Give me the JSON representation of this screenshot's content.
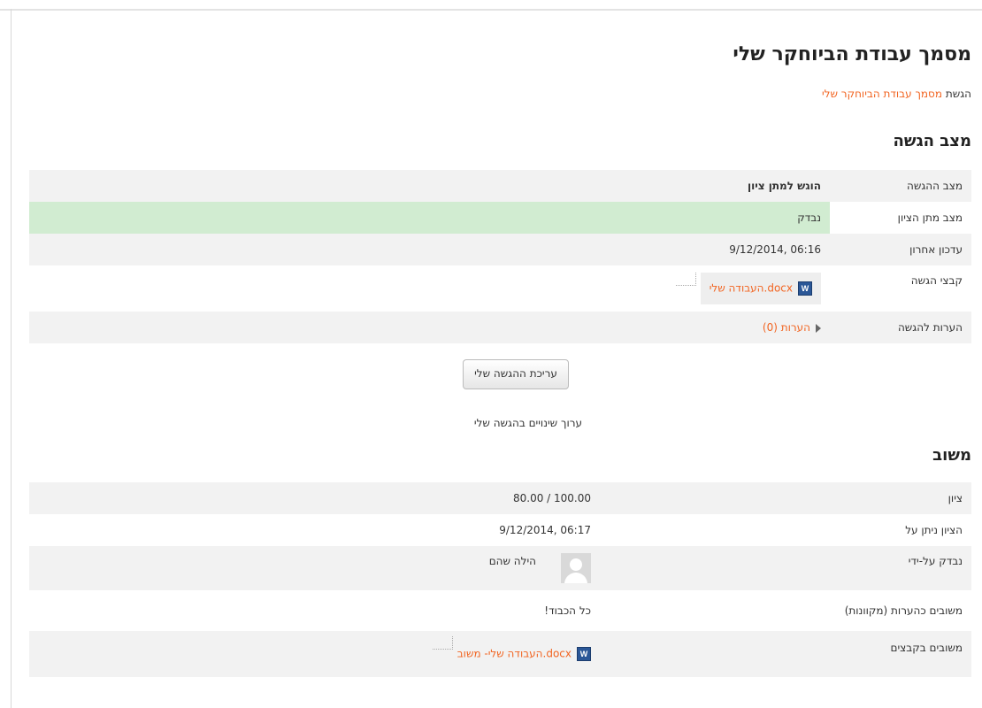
{
  "title": "מסמך עבודת הביוחקר שלי",
  "breadcrumb": {
    "prefix": "הגשת",
    "link": "מסמך עבודת הביוחקר שלי"
  },
  "submission_status": {
    "heading": "מצב הגשה",
    "rows": {
      "status_label": "מצב ההגשה",
      "status_value": "הוגש למתן ציון",
      "grading_label": "מצב מתן הציון",
      "grading_value": "נבדק",
      "modified_label": "עדכון אחרון",
      "modified_value": "9/12/2014, 06:16",
      "files_label": "קבצי הגשה",
      "file_name": "העבודה שלי.docx",
      "comments_label": "הערות להגשה",
      "comments_link": "הערות (0)"
    },
    "edit_button": "עריכת ההגשה שלי",
    "edit_hint": "ערוך שינויים בהגשה שלי"
  },
  "feedback": {
    "heading": "משוב",
    "rows": {
      "grade_label": "ציון",
      "grade_value": "80.00 / 100.00",
      "graded_on_label": "הציון ניתן על",
      "graded_on_value": "9/12/2014, 06:17",
      "graded_by_label": "נבדק על-ידי",
      "graded_by_value": "הילה שהם",
      "comments_label": "משובים כהערות (מקוונות)",
      "comments_value": "כל הכבוד!",
      "files_label": "משובים בקבצים",
      "file_name": "העבודה שלי- משוב.docx"
    }
  },
  "icons": {
    "word": "W"
  },
  "colors": {
    "link": "#f26522",
    "graded_bg": "#d1ecd1",
    "row_alt": "#f2f2f2"
  }
}
